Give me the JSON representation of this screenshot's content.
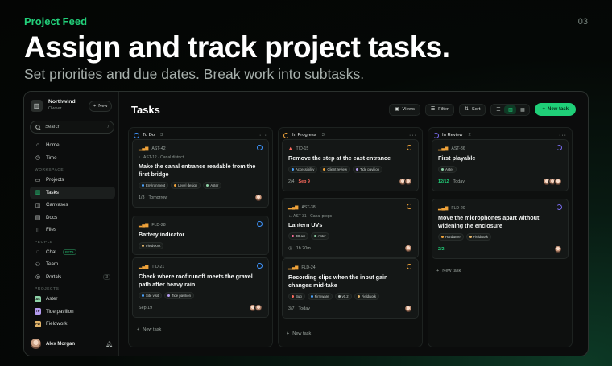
{
  "slide": {
    "kicker": "Project Feed",
    "page_number": "03",
    "headline": "Assign and track project tasks.",
    "subline": "Set priorities and due dates. Break work into subtasks."
  },
  "workspace": {
    "name": "Northwind",
    "role": "Owner",
    "new_label": "New"
  },
  "search": {
    "placeholder": "Search",
    "shortcut": "/"
  },
  "nav": {
    "home": "Home",
    "time": "Time",
    "workspace_section": "WORKSPACE",
    "projects": "Projects",
    "tasks": "Tasks",
    "canvases": "Canvases",
    "docs": "Docs",
    "files": "Files",
    "people_section": "PEOPLE",
    "chat": "Chat",
    "chat_badge": "BETA",
    "team": "Team",
    "portals": "Portals",
    "portals_count": "3",
    "projects_section": "PROJECTS",
    "project_items": [
      {
        "label": "Aster",
        "abbr": "AS",
        "color": "#8fd3a8"
      },
      {
        "label": "Tide pavilion",
        "abbr": "TP",
        "color": "#b59cf0"
      },
      {
        "label": "Fieldwork",
        "abbr": "FW",
        "color": "#e0b36a"
      }
    ]
  },
  "user": {
    "name": "Alex Morgan"
  },
  "main": {
    "title": "Tasks",
    "views_label": "Views",
    "filter_label": "Filter",
    "sort_label": "Sort",
    "new_task_label": "New task"
  },
  "columns": [
    {
      "name": "To Do",
      "count": "3",
      "add_label": "New task",
      "cards": [
        {
          "id": "AST-42",
          "parent": "AST-12 · Canal district",
          "title": "Make the canal entrance readable from the first bridge",
          "tags": [
            "Environment",
            "Level design",
            "Aster"
          ],
          "subtasks": "1/3",
          "due": "Tomorrow"
        },
        {
          "id": "FLD-28",
          "title": "Battery indicator",
          "tags": [
            "Fieldwork"
          ]
        },
        {
          "id": "TID-21",
          "title": "Check where roof runoff meets the gravel path after heavy rain",
          "tags": [
            "Site visit",
            "Tide pavilion"
          ],
          "due": "Sep 19"
        }
      ]
    },
    {
      "name": "In Progress",
      "count": "3",
      "add_label": "New task",
      "cards": [
        {
          "id": "TID-15",
          "title": "Remove the step at the east entrance",
          "tags": [
            "Accessibility",
            "Client review",
            "Tide pavilion"
          ],
          "subtasks": "2/4",
          "due": "Sep 9"
        },
        {
          "id": "AST-38",
          "parent": "AST-31 · Canal props",
          "title": "Lantern UVs",
          "tags": [
            "3D art",
            "Aster"
          ],
          "time": "1h 20m"
        },
        {
          "id": "FLD-24",
          "title": "Recording clips when the input gain changes mid-take",
          "tags": [
            "Bug",
            "Firmware",
            "v0.2",
            "Fieldwork"
          ],
          "subtasks": "3/7",
          "due": "Today"
        }
      ]
    },
    {
      "name": "In Review",
      "count": "2",
      "add_label": "New task",
      "cards": [
        {
          "id": "AST-36",
          "title": "First playable",
          "tags": [
            "Aster"
          ],
          "subtasks": "12/12",
          "due": "Today"
        },
        {
          "id": "FLD-20",
          "title": "Move the microphones apart without widening the enclosure",
          "tags": [
            "Hardware",
            "Fieldwork"
          ],
          "subtasks": "2/2"
        }
      ]
    }
  ]
}
